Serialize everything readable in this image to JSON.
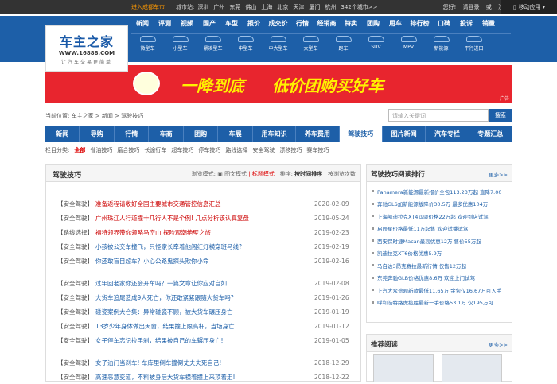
{
  "topbar": {
    "enter": "进入成都车市",
    "cities_label": "城市站:",
    "cities": [
      "深圳",
      "广州",
      "东莞",
      "佛山",
      "上海",
      "北京",
      "天津",
      "厦门",
      "杭州",
      "342个城市>>"
    ],
    "greeting": "您好!",
    "login": "请登录",
    "or": "或",
    "register": "注册",
    "mobile": "移动应用"
  },
  "logo": {
    "cn": "车主之家",
    "url": "WWW.16888.COM",
    "slogan": "让汽车交易更简单"
  },
  "nav": {
    "primary": [
      "新闻",
      "评测",
      "视频",
      "国产",
      "车型",
      "报价",
      "成交价",
      "行情",
      "经销商",
      "特卖",
      "团购",
      "用车",
      "排行榜",
      "口碑",
      "投诉",
      "销量"
    ],
    "cars": [
      "微型车",
      "小型车",
      "紧凑型车",
      "中型车",
      "中大型车",
      "大型车",
      "跑车",
      "SUV",
      "MPV",
      "新能源",
      "平行进口"
    ]
  },
  "banner": {
    "text1": "一降到底",
    "text2": "低价团购买好车",
    "ad": "广告"
  },
  "breadcrumb": "当前位置: 车主之家 > 新闻 > 驾驶技巧",
  "search": {
    "placeholder": "请输入关键词",
    "button": "搜索"
  },
  "tabs": [
    "新闻",
    "导购",
    "行情",
    "车商",
    "团购",
    "车展",
    "用车知识",
    "养车费用",
    "驾驶技巧",
    "图片新闻",
    "汽车专栏",
    "专题汇总"
  ],
  "tabs_active_index": 8,
  "subcat": {
    "label": "栏目分类:",
    "items": [
      "全部",
      "省油技巧",
      "磨合技巧",
      "长途行车",
      "超车技巧",
      "停车技巧",
      "路线选择",
      "安全驾驶",
      "漂移技巧",
      "赛车技巧"
    ]
  },
  "main": {
    "title": "驾驶技巧",
    "mode_label": "浏览模式:",
    "mode_text": "图文模式",
    "mode_title": "标题模式",
    "sort_label": "排序:",
    "sort_time": "按时间排序",
    "sort_views": "按浏览次数",
    "groups": [
      [
        {
          "cat": "【安全驾驶】",
          "title": "准备返程请收好全国主要城市交通管控信息汇总",
          "date": "2020-02-09",
          "red": true
        },
        {
          "cat": "【安全驾驶】",
          "title": "广州珠江人行道撞十几行人不是个例! 几点分析该认真复盘",
          "date": "2019-05-24",
          "red": true
        },
        {
          "cat": "【路线选择】",
          "title": "福特领界带你领略马峦山 探险观潮绝壁之旅",
          "date": "2019-02-23",
          "red": true
        },
        {
          "cat": "【安全驾驶】",
          "title": "小孩被公交车撞飞，只怪家长牵着他闯红灯横穿斑马线?",
          "date": "2019-02-19",
          "red": false
        },
        {
          "cat": "【安全驾驶】",
          "title": "你还敢盲目超车？小心公路鬼探头欺你小命",
          "date": "2019-02-16",
          "red": false
        }
      ],
      [
        {
          "cat": "【安全驾驶】",
          "title": "过年回老家你还会开车吗？一篇文章让你应对自如",
          "date": "2019-02-08",
          "red": false
        },
        {
          "cat": "【安全驾驶】",
          "title": "大货车追尾造成9人死亡，你还敢紧紧跟随大货车吗?",
          "date": "2019-01-26",
          "red": false
        },
        {
          "cat": "【安全驾驶】",
          "title": "碰瓷案例大合集：异常碰瓷不顾，被大货车碾压身亡",
          "date": "2019-01-19",
          "red": false
        },
        {
          "cat": "【安全驾驶】",
          "title": "13岁少年身体做出天窗，结果撞上限高杆，当场身亡",
          "date": "2019-01-12",
          "red": false
        },
        {
          "cat": "【安全驾驶】",
          "title": "女子停车忘记拉手刹，结果被自己的车辗压身亡!",
          "date": "2019-01-05",
          "red": false
        }
      ],
      [
        {
          "cat": "【安全驾驶】",
          "title": "女子油门当刹车! 车库里倒车撞倒丈夫夫死自己!",
          "date": "2018-12-29",
          "red": false
        },
        {
          "cat": "【安全驾驶】",
          "title": "高速恶意变道，不料被身后大货车横着撞上来顶着走!",
          "date": "2018-12-22",
          "red": false
        }
      ]
    ]
  },
  "side": {
    "title": "驾驶技巧阅读排行",
    "more": "更多>>",
    "items": [
      "Panamera新能源最新报价全包113.23万起 直降7.00",
      "奔驰GLS加新能源版降价30.5万 最多优惠104万",
      "上海凯迪拉克XT4四驱价格22万起 欢迎到店试驾",
      "启辰星价格最低11万起售 欢迎试乘试驾",
      "西安保时捷Macan最高优惠12万 售价55万起",
      "凯迪拉克XT6价格优惠5.9万",
      "马自达3昂克赛拉最新行情 仅售12万起",
      "东莞奔驰GLB价格优惠8.6万 欢迎上门试驾",
      "上汽大众途观新款最低11.65万 金包仅16.67万可入手",
      "呼和浩特路虎揽胜最新一手价格53.1万 仅195万可"
    ]
  },
  "recommend": {
    "title": "推荐阅读",
    "more": "更多>>"
  }
}
